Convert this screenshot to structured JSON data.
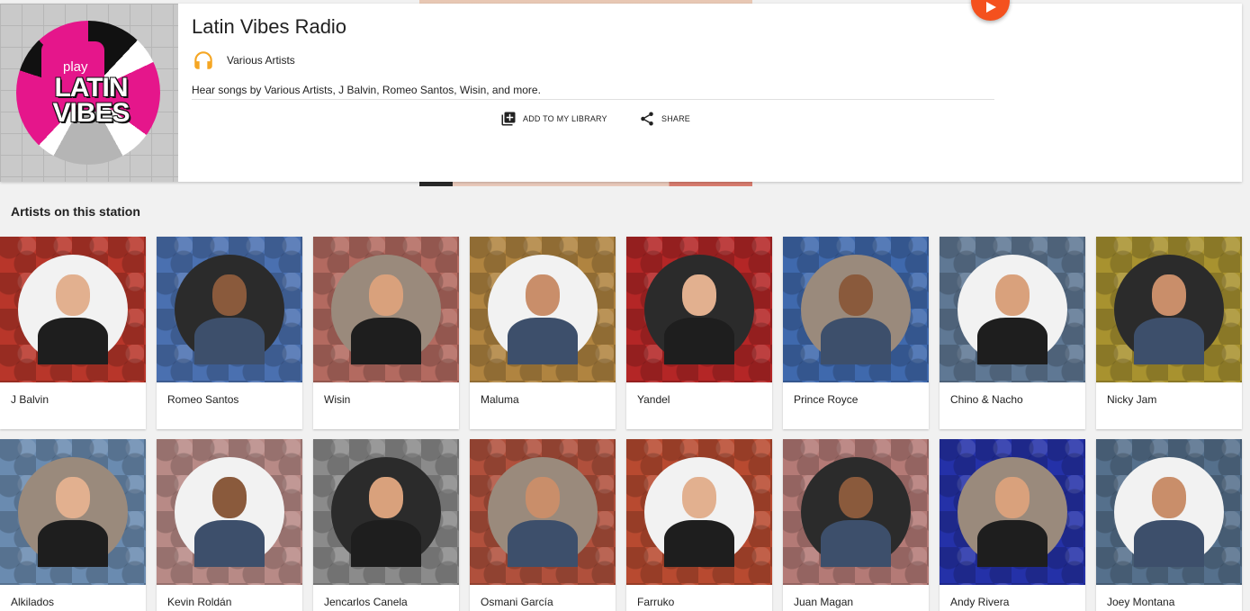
{
  "station": {
    "title": "Latin Vibes Radio",
    "artist_label": "Various Artists",
    "description": "Hear songs by Various Artists, J Balvin, Romeo Santos, Wisin, and more.",
    "logo_play": "play",
    "logo_text": "LATIN VIBES",
    "add_library_label": "ADD TO MY LIBRARY",
    "share_label": "SHARE"
  },
  "section_title": "Artists on this station",
  "colors": {
    "accent": "#f4511e",
    "logo_pink": "#e5168b",
    "headphones": "#f5a623"
  },
  "artists": [
    {
      "name": "J Balvin",
      "bg": "#b8362a"
    },
    {
      "name": "Romeo Santos",
      "bg": "#4a70b0"
    },
    {
      "name": "Wisin",
      "bg": "#b36a60"
    },
    {
      "name": "Maluma",
      "bg": "#b08440"
    },
    {
      "name": "Yandel",
      "bg": "#b42626"
    },
    {
      "name": "Prince Royce",
      "bg": "#3f69ad"
    },
    {
      "name": "Chino & Nacho",
      "bg": "#5f7894"
    },
    {
      "name": "Nicky Jam",
      "bg": "#a8922f"
    },
    {
      "name": "Alkilados",
      "bg": "#6a8bb0"
    },
    {
      "name": "Kevin Roldán",
      "bg": "#b88a86"
    },
    {
      "name": "Jencarlos Canela",
      "bg": "#8b8b8b"
    },
    {
      "name": "Osmani García",
      "bg": "#b0503c"
    },
    {
      "name": "Farruko",
      "bg": "#b84a30"
    },
    {
      "name": "Juan Magan",
      "bg": "#b47a76"
    },
    {
      "name": "Andy Rivera",
      "bg": "#2431a8"
    },
    {
      "name": "Joey Montana",
      "bg": "#55708c"
    }
  ]
}
